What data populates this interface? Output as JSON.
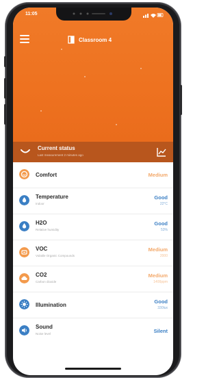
{
  "statusbar": {
    "time": "11:05"
  },
  "header": {
    "title": "Classroom 4"
  },
  "current_status": {
    "title": "Current status",
    "subtitle": "Last measurement 2 minutes ago"
  },
  "rows": [
    {
      "name": "Comfort",
      "sub": "",
      "status": "Medium",
      "value": "",
      "level": "medium",
      "icon": "comfort-icon",
      "color": "#f39a4c"
    },
    {
      "name": "Temperature",
      "sub": "Indoor",
      "status": "Good",
      "value": "22°C",
      "level": "good",
      "icon": "temperature-drop-icon",
      "color": "#3b7fc4"
    },
    {
      "name": "H2O",
      "sub": "Relative humidity",
      "status": "Good",
      "value": "53%",
      "level": "good",
      "icon": "humidity-drop-icon",
      "color": "#3b7fc4"
    },
    {
      "name": "VOC",
      "sub": "Volatile Organic Compounds",
      "status": "Medium",
      "value": "2000",
      "level": "medium",
      "icon": "voc-icon",
      "color": "#f39a4c"
    },
    {
      "name": "CO2",
      "sub": "Carbon dioxide",
      "status": "Medium",
      "value": "1400ppm",
      "level": "medium",
      "icon": "co2-cloud-icon",
      "color": "#f39a4c"
    },
    {
      "name": "Illumination",
      "sub": "",
      "status": "Good",
      "value": "330lux",
      "level": "good",
      "icon": "sun-icon",
      "color": "#3b7fc4"
    },
    {
      "name": "Sound",
      "sub": "Noise level",
      "status": "Silent",
      "value": "",
      "level": "good",
      "icon": "speaker-icon",
      "color": "#3b7fc4"
    }
  ]
}
